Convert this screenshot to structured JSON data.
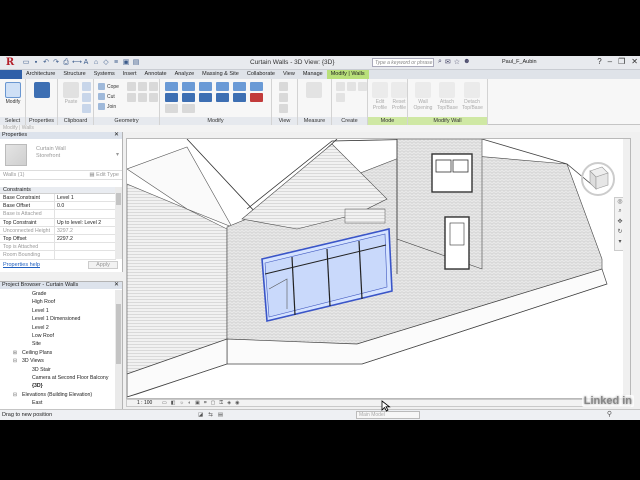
{
  "app": {
    "window_title": "Curtain Walls - 3D View: {3D}",
    "search_placeholder": "Type a keyword or phrase",
    "user": "Paul_F_Aubin"
  },
  "ribbon": {
    "tabs": [
      "Architecture",
      "Structure",
      "Systems",
      "Insert",
      "Annotate",
      "Analyze",
      "Massing & Site",
      "Collaborate",
      "View",
      "Manage",
      "Modify | Walls"
    ],
    "active_tab": "Modify | Walls",
    "groups": {
      "select": "Select",
      "properties": "Properties",
      "clipboard": "Clipboard",
      "geometry": "Geometry",
      "modify": "Modify",
      "view": "View",
      "measure": "Measure",
      "create": "Create",
      "mode": "Mode",
      "modify_wall": "Modify Wall"
    },
    "buttons": {
      "modify": "Modify",
      "paste": "Paste",
      "cope": "Cope",
      "cut": "Cut",
      "join": "Join",
      "edit_profile": "Edit Profile",
      "reset_profile": "Reset Profile",
      "wall_opening": "Wall Opening",
      "attach": "Attach Top/Base",
      "detach": "Detach Top/Base"
    },
    "context_label": "Modify | Walls"
  },
  "properties": {
    "header": "Properties",
    "type_name": "Curtain Wall\nStorefront",
    "instance_filter": "Walls (1)",
    "edit_type": "Edit Type",
    "section": "Constraints",
    "rows": [
      {
        "k": "Base Constraint",
        "v": "Level 1",
        "dim": false
      },
      {
        "k": "Base Offset",
        "v": "0.0",
        "dim": false
      },
      {
        "k": "Base is Attached",
        "v": "",
        "dim": true
      },
      {
        "k": "Top Constraint",
        "v": "Up to level: Level 2",
        "dim": false
      },
      {
        "k": "Unconnected Height",
        "v": "3297.2",
        "dim": true
      },
      {
        "k": "Top Offset",
        "v": "2297.2",
        "dim": false
      },
      {
        "k": "Top is Attached",
        "v": "",
        "dim": true
      },
      {
        "k": "Room Bounding",
        "v": "",
        "dim": true
      }
    ],
    "help": "Properties help",
    "apply": "Apply"
  },
  "browser": {
    "header": "Project Browser - Curtain Walls",
    "nodes": [
      {
        "label": "Grade",
        "indent": 1,
        "toggle": ""
      },
      {
        "label": "High Roof",
        "indent": 1,
        "toggle": ""
      },
      {
        "label": "Level 1",
        "indent": 1,
        "toggle": ""
      },
      {
        "label": "Level 1 Dimensioned",
        "indent": 1,
        "toggle": ""
      },
      {
        "label": "Level 2",
        "indent": 1,
        "toggle": ""
      },
      {
        "label": "Low Roof",
        "indent": 1,
        "toggle": ""
      },
      {
        "label": "Site",
        "indent": 1,
        "toggle": ""
      },
      {
        "label": "Ceiling Plans",
        "indent": 0,
        "toggle": "+"
      },
      {
        "label": "3D Views",
        "indent": 0,
        "toggle": "−"
      },
      {
        "label": "3D Stair",
        "indent": 1,
        "toggle": ""
      },
      {
        "label": "Camera at Second Floor Balcony",
        "indent": 1,
        "toggle": ""
      },
      {
        "label": "{3D}",
        "indent": 1,
        "toggle": "",
        "bold": true
      },
      {
        "label": "Elevations (Building Elevation)",
        "indent": 0,
        "toggle": "−"
      },
      {
        "label": "East",
        "indent": 1,
        "toggle": ""
      }
    ]
  },
  "view_control": {
    "scale": "1 : 100"
  },
  "status": {
    "text": "Drag to new position",
    "model": "Main Model"
  },
  "watermark": "Linked in"
}
